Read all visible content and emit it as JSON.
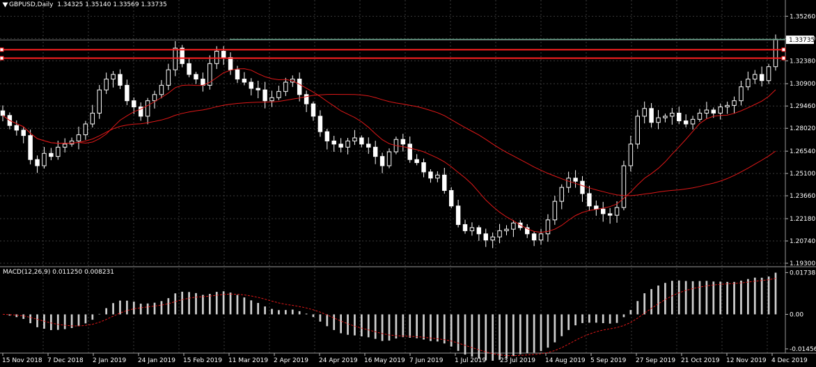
{
  "window": {
    "symbol_label": "GBPUSD,Daily",
    "ohlc": [
      "1.34325",
      "1.35140",
      "1.33569",
      "1.33735"
    ],
    "current_price_label": "1.33735"
  },
  "macd": {
    "label": "MACD(12,26,9)",
    "values": [
      "0.011250",
      "0.008231"
    ],
    "axis_labels": [
      "0.01738",
      "0.00",
      "-0.01456"
    ],
    "range": [
      -0.0152,
      0.0184
    ],
    "zero_label": "0.00"
  },
  "colors": {
    "background": "#000000",
    "candle": "#ffffff",
    "grid": "#3c3c3c",
    "ma": "#e01818",
    "horizontal_level": "#ff2020",
    "high_line": "#5fae8f",
    "macd_signal": "#e01818"
  },
  "chart_data": {
    "type": "candlestick",
    "symbol": "GBPUSD",
    "timeframe": "Daily",
    "ylim": [
      1.193,
      1.3595
    ],
    "price_ticks": [
      "1.35260",
      "1.33820",
      "1.32380",
      "1.30900",
      "1.29460",
      "1.28020",
      "1.26540",
      "1.25100",
      "1.23660",
      "1.22180",
      "1.20740",
      "1.19300"
    ],
    "x_ticks": [
      "15 Nov 2018",
      "7 Dec 2018",
      "2 Jan 2019",
      "24 Jan 2019",
      "15 Feb 2019",
      "11 Mar 2019",
      "2 Apr 2019",
      "24 Apr 2019",
      "16 May 2019",
      "7 Jun 2019",
      "1 Jul 2019",
      "23 Jul 2019",
      "14 Aug 2019",
      "5 Sep 2019",
      "27 Sep 2019",
      "21 Oct 2019",
      "12 Nov 2019",
      "4 Dec 2019"
    ],
    "horizontal_lines": [
      1.331,
      1.3255
    ],
    "high_line_level": 1.3373,
    "series": [
      {
        "name": "close",
        "values": [
          1.2885,
          1.282,
          1.279,
          1.2755,
          1.26,
          1.256,
          1.264,
          1.262,
          1.268,
          1.27,
          1.272,
          1.276,
          1.283,
          1.29,
          1.305,
          1.312,
          1.315,
          1.308,
          1.298,
          1.294,
          1.288,
          1.298,
          1.302,
          1.308,
          1.318,
          1.332,
          1.322,
          1.315,
          1.312,
          1.308,
          1.322,
          1.33,
          1.326,
          1.318,
          1.312,
          1.31,
          1.306,
          1.305,
          1.298,
          1.3,
          1.304,
          1.31,
          1.312,
          1.302,
          1.296,
          1.288,
          1.278,
          1.272,
          1.27,
          1.268,
          1.272,
          1.274,
          1.27,
          1.268,
          1.262,
          1.256,
          1.265,
          1.273,
          1.27,
          1.26,
          1.258,
          1.252,
          1.248,
          1.25,
          1.24,
          1.23,
          1.218,
          1.214,
          1.216,
          1.212,
          1.208,
          1.21,
          1.214,
          1.215,
          1.219,
          1.216,
          1.212,
          1.208,
          1.212,
          1.221,
          1.233,
          1.242,
          1.248,
          1.246,
          1.238,
          1.23,
          1.228,
          1.225,
          1.224,
          1.229,
          1.256,
          1.27,
          1.288,
          1.293,
          1.284,
          1.287,
          1.288,
          1.29,
          1.285,
          1.283,
          1.286,
          1.29,
          1.292,
          1.29,
          1.294,
          1.295,
          1.298,
          1.307,
          1.312,
          1.315,
          1.311,
          1.32,
          1.3374
        ]
      },
      {
        "name": "ma_fast",
        "values": []
      },
      {
        "name": "ma_slow",
        "values": []
      }
    ]
  }
}
